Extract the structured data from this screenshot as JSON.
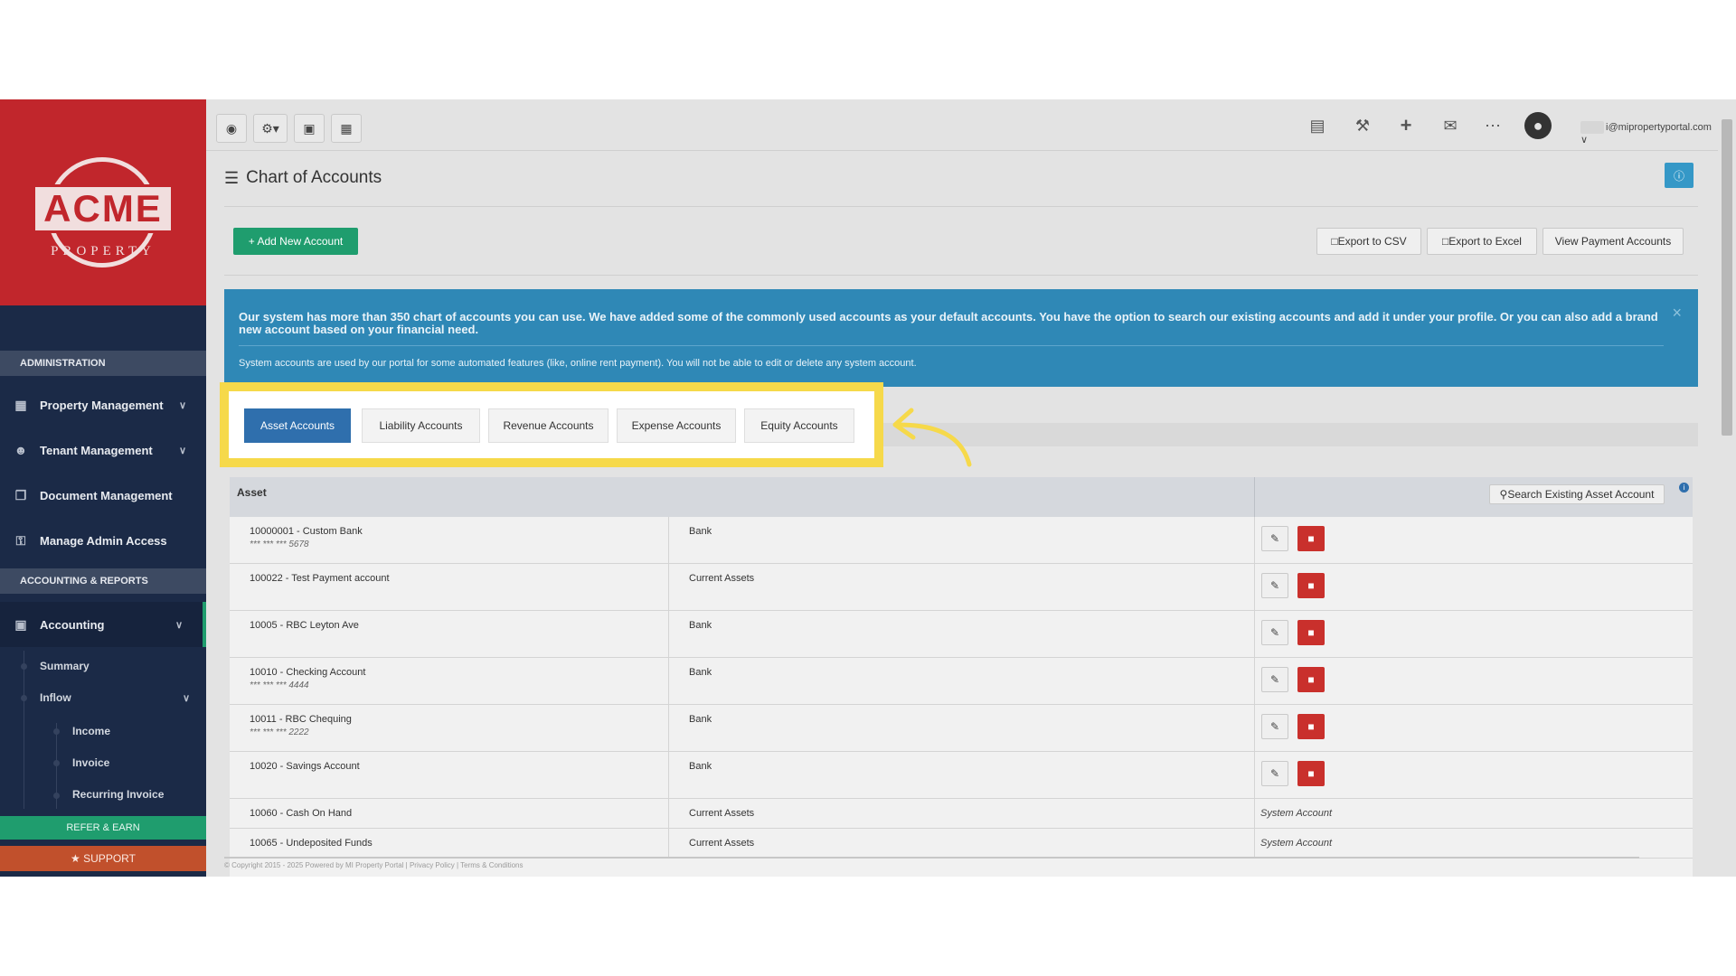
{
  "sidebar": {
    "logo": {
      "brand": "ACME",
      "sub": "PROPERTY"
    },
    "sections": {
      "admin": "ADMINISTRATION",
      "accounting": "ACCOUNTING & REPORTS"
    },
    "items": [
      {
        "label": "Property Management",
        "icon": "building-icon"
      },
      {
        "label": "Tenant Management",
        "icon": "users-icon"
      },
      {
        "label": "Document Management",
        "icon": "copy-icon"
      },
      {
        "label": "Manage Admin Access",
        "icon": "key-icon"
      },
      {
        "label": "Accounting",
        "icon": "money-icon"
      }
    ],
    "subitems": {
      "summary": "Summary",
      "inflow": "Inflow",
      "income": "Income",
      "invoice": "Invoice",
      "recurring": "Recurring Invoice"
    },
    "refer": "REFER & EARN",
    "support": "SUPPORT"
  },
  "topbar": {
    "user_email": "i@mipropertyportal.com"
  },
  "page": {
    "title": "Chart of Accounts",
    "add_button": "+ Add New Account",
    "export_csv": "Export to CSV",
    "export_excel": "Export to Excel",
    "view_payment": "View Payment Accounts"
  },
  "alert": {
    "message": "Our system has more than 350 chart of accounts you can use. We have added some of the commonly used accounts as your default accounts. You have the option to search our existing accounts and add it under your profile. Or you can also add a brand new account based on your financial need.",
    "note": "System accounts are used by our portal for some automated features (like, online rent payment). You will not be able to edit or delete any system account."
  },
  "tabs": [
    "Asset Accounts",
    "Liability Accounts",
    "Revenue Accounts",
    "Expense Accounts",
    "Equity Accounts"
  ],
  "table": {
    "header": "Asset",
    "search_button": "Search Existing Asset Account",
    "rows": [
      {
        "name": "10000001 - Custom Bank",
        "mask": "*** *** *** 5678",
        "type": "Bank",
        "system": ""
      },
      {
        "name": "100022 - Test Payment account",
        "mask": "",
        "type": "Current Assets",
        "system": ""
      },
      {
        "name": "10005 - RBC Leyton Ave",
        "mask": "",
        "type": "Bank",
        "system": ""
      },
      {
        "name": "10010 - Checking Account",
        "mask": "*** *** *** 4444",
        "type": "Bank",
        "system": ""
      },
      {
        "name": "10011 - RBC Chequing",
        "mask": "*** *** *** 2222",
        "type": "Bank",
        "system": ""
      },
      {
        "name": "10020 - Savings Account",
        "mask": "",
        "type": "Bank",
        "system": ""
      },
      {
        "name": "10060 - Cash On Hand",
        "mask": "",
        "type": "Current Assets",
        "system": "System Account"
      },
      {
        "name": "10065 - Undeposited Funds",
        "mask": "",
        "type": "Current Assets",
        "system": "System Account"
      }
    ]
  },
  "footer": "© Copyright 2015 - 2025 Powered by MI Property Portal | Privacy Policy | Terms & Conditions",
  "colors": {
    "brand_red": "#c1262c",
    "sidebar": "#1b2a47",
    "accent_green": "#1f9d6e",
    "tab_active": "#2f6fad",
    "highlight": "#f6d94a",
    "delete_red": "#c9302c"
  }
}
